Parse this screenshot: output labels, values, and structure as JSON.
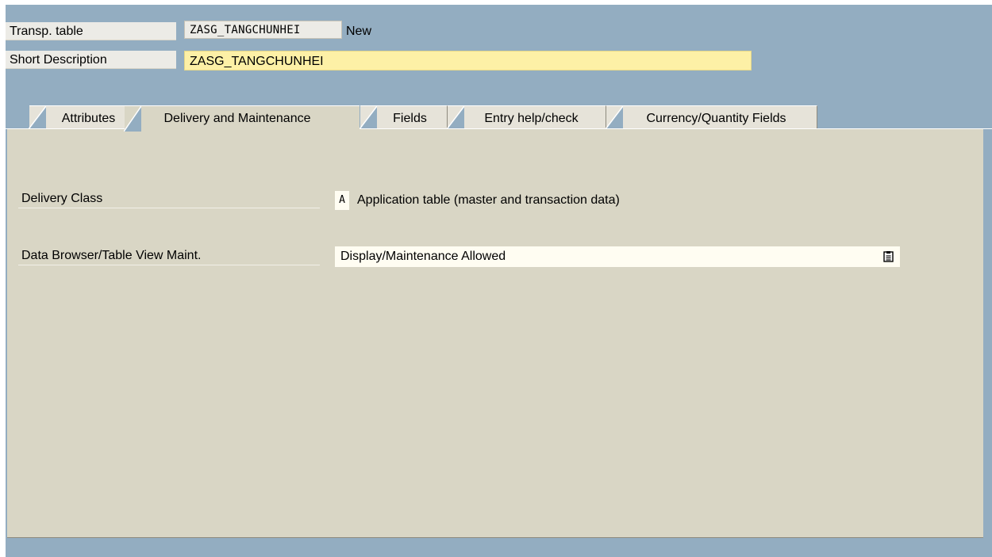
{
  "header": {
    "table_label": "Transp. table",
    "table_name": "ZASG_TANGCHUNHEI",
    "table_status": "New",
    "desc_label": "Short Description",
    "desc_value": "ZASG_TANGCHUNHEI"
  },
  "tabs": [
    {
      "label": "Attributes",
      "active": false
    },
    {
      "label": "Delivery and Maintenance",
      "active": true
    },
    {
      "label": "Fields",
      "active": false
    },
    {
      "label": "Entry help/check",
      "active": false
    },
    {
      "label": "Currency/Quantity Fields",
      "active": false
    }
  ],
  "panel": {
    "delivery_class_label": "Delivery Class",
    "delivery_class_code": "A",
    "delivery_class_text": "Application table (master and transaction data)",
    "browser_label": "Data Browser/Table View Maint.",
    "browser_value": "Display/Maintenance Allowed",
    "browser_help_icon": "value-help-icon"
  },
  "colors": {
    "background": "#93adc1",
    "panel": "#d9d6c5",
    "required_field": "#fdf0a6"
  }
}
